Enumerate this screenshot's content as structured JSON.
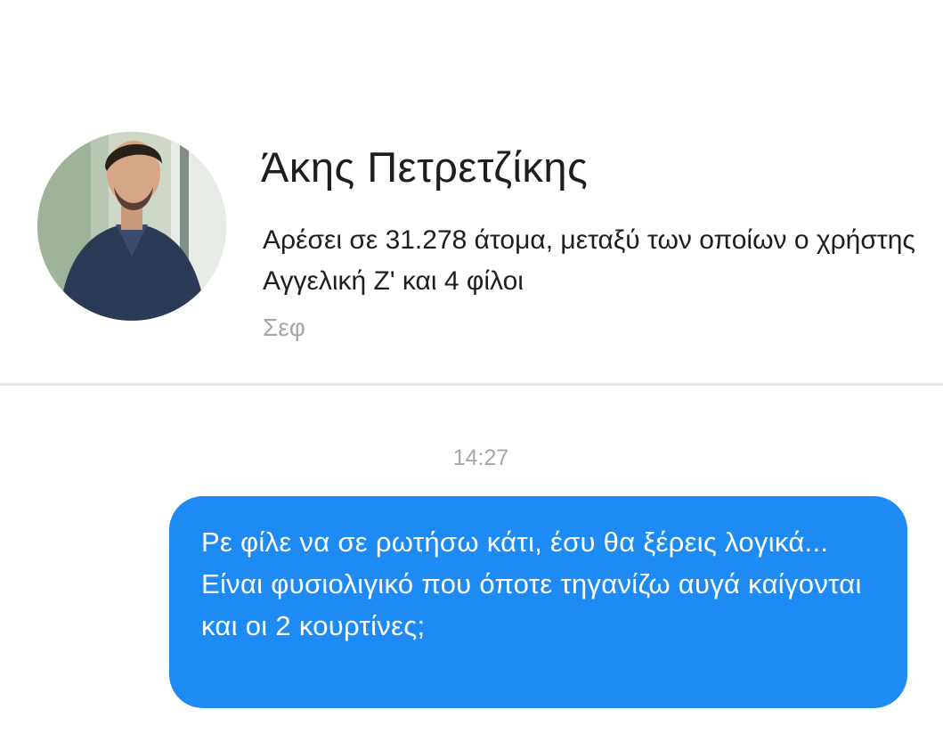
{
  "profile": {
    "name": "Άκης Πετρετζίκης",
    "likes_text": "Αρέσει σε 31.278 άτομα, μεταξύ των οποίων ο χρήστης Αγγελική Ζ' και 4 φίλοι",
    "category": "Σεφ",
    "avatar": "profile-photo"
  },
  "conversation": {
    "timestamp": "14:27",
    "messages": [
      {
        "direction": "outgoing",
        "text": "Ρε φίλε να σε ρωτήσω κάτι, έσυ θα ξέρεις λογικά... Είναι φυσιολιγικό που όποτε τηγανίζω αυγά καίγονται και οι 2 κουρτίνες;"
      }
    ]
  },
  "colors": {
    "bubble": "#1d8bf3",
    "text_primary": "#1c1e21",
    "text_muted": "#a4a7ab",
    "divider": "#e4e6e9"
  }
}
